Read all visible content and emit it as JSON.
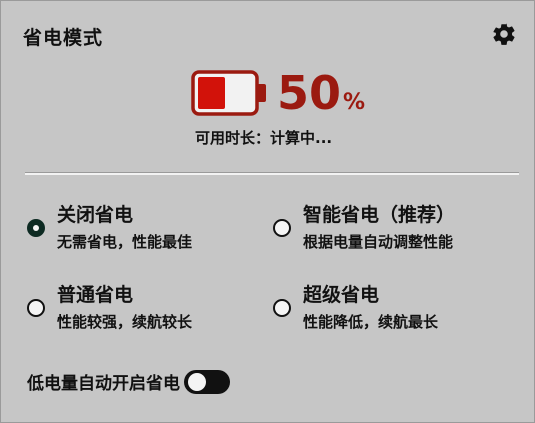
{
  "panel": {
    "title": "省电模式",
    "settings_icon": "gear-icon"
  },
  "battery": {
    "level_fraction": 0.5,
    "percent_value": "50",
    "percent_unit": "%",
    "remaining_text": "可用时长：计算中...",
    "colors": {
      "fill": "#d2120a",
      "outline": "#9b1a10",
      "text": "#9b1a10"
    }
  },
  "modes": [
    {
      "title": "关闭省电",
      "description": "无需省电，性能最佳",
      "selected": true
    },
    {
      "title": "智能省电（推荐）",
      "description": "根据电量自动调整性能",
      "selected": false
    },
    {
      "title": "普通省电",
      "description": "性能较强，续航较长",
      "selected": false
    },
    {
      "title": "超级省电",
      "description": "性能降低，续航最长",
      "selected": false
    }
  ],
  "auto_enable": {
    "label": "低电量自动开启省电",
    "enabled": false
  }
}
